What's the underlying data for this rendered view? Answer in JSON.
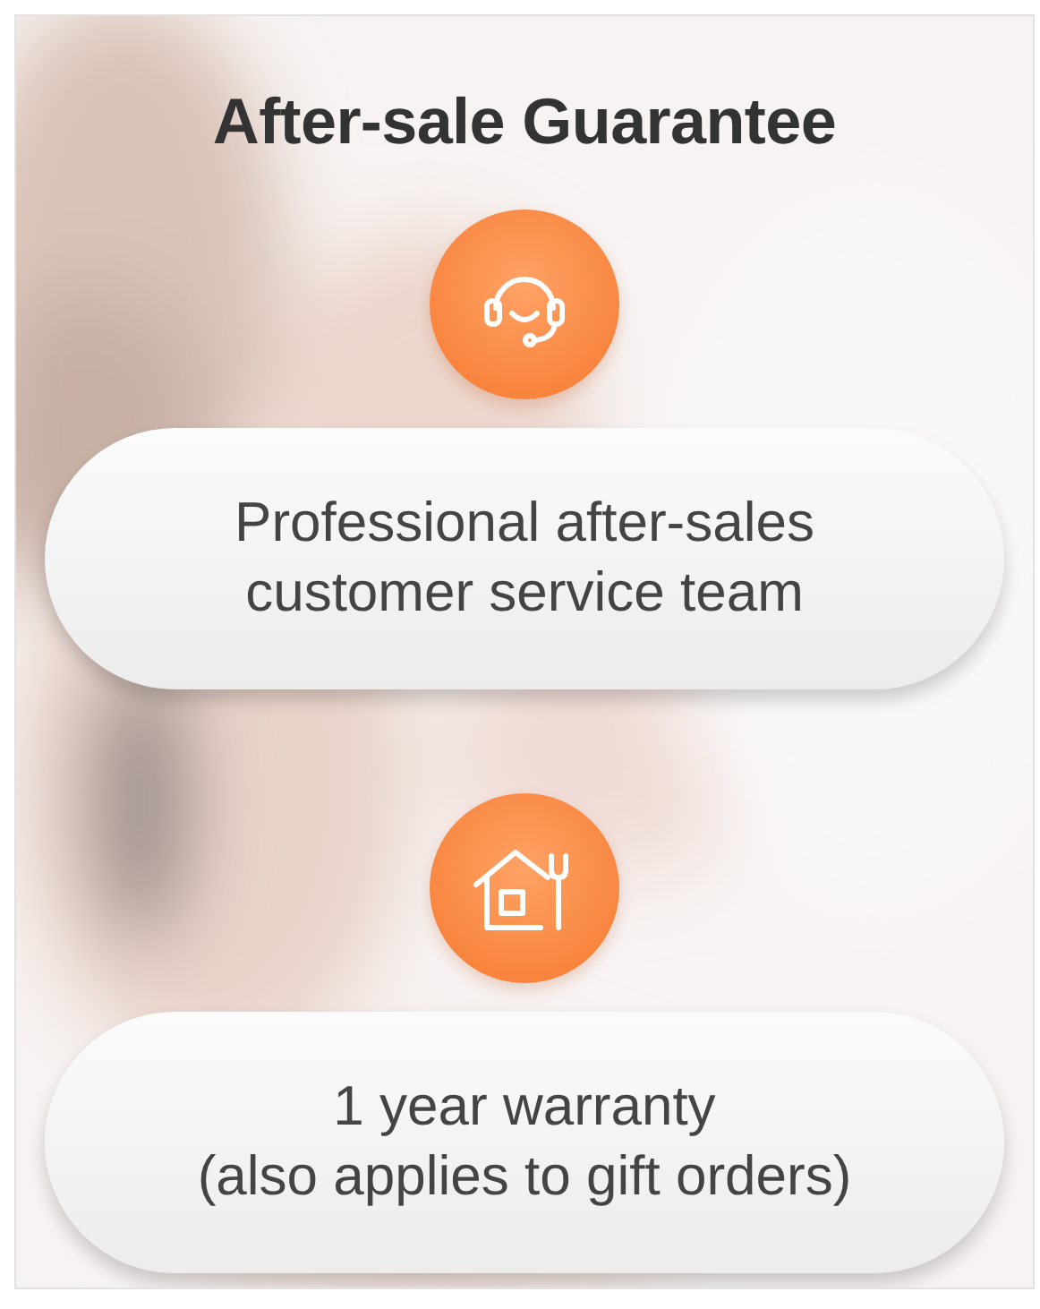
{
  "title": "After-sale Guarantee",
  "features": [
    {
      "kind": "headset",
      "lines": [
        "Professional after-sales",
        "customer service team"
      ]
    },
    {
      "kind": "house-tools",
      "lines": [
        "1 year warranty",
        "(also applies to gift orders)"
      ]
    }
  ]
}
